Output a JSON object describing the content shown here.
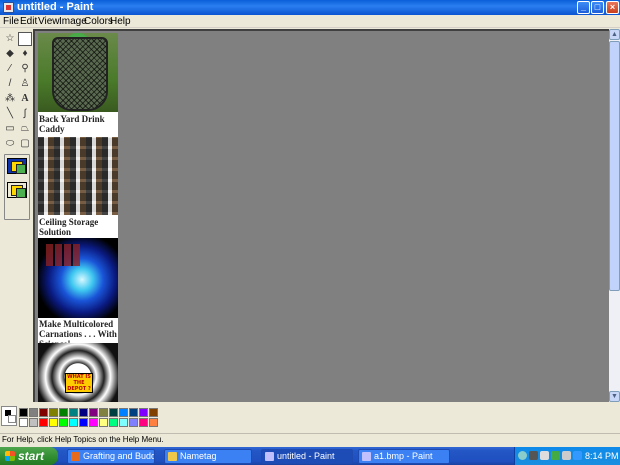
{
  "window": {
    "title": "untitled - Paint"
  },
  "titlebar_buttons": {
    "minimize": "_",
    "maximize": "□",
    "close": "×"
  },
  "menu": [
    {
      "label": "File"
    },
    {
      "label": "Edit"
    },
    {
      "label": "View"
    },
    {
      "label": "Image"
    },
    {
      "label": "Colors"
    },
    {
      "label": "Help"
    }
  ],
  "tools": [
    {
      "name": "free-select-icon",
      "glyph": "☆"
    },
    {
      "name": "rect-select-icon",
      "glyph": ""
    },
    {
      "name": "eraser-icon",
      "glyph": "◆"
    },
    {
      "name": "fill-icon",
      "glyph": "♦"
    },
    {
      "name": "eyedropper-icon",
      "glyph": "⁄"
    },
    {
      "name": "magnifier-icon",
      "glyph": "⚲"
    },
    {
      "name": "pencil-icon",
      "glyph": "/"
    },
    {
      "name": "brush-icon",
      "glyph": "♙"
    },
    {
      "name": "airbrush-icon",
      "glyph": "⁂"
    },
    {
      "name": "text-icon",
      "glyph": "A"
    },
    {
      "name": "line-icon",
      "glyph": "╲"
    },
    {
      "name": "curve-icon",
      "glyph": "∫"
    },
    {
      "name": "rectangle-icon",
      "glyph": "▭"
    },
    {
      "name": "polygon-icon",
      "glyph": "⏢"
    },
    {
      "name": "ellipse-icon",
      "glyph": "⬭"
    },
    {
      "name": "rounded-rect-icon",
      "glyph": "▢"
    }
  ],
  "canvas": {
    "captions": [
      "Back Yard Drink Caddy",
      "Ceiling Storage Solution",
      "Make Multicolored Carnations . . . With Science!"
    ],
    "sign_text": "WHAT IS THE DEPOT ?"
  },
  "palette": {
    "foreground": "#000000",
    "background": "#ffffff",
    "top_row": [
      "#000000",
      "#808080",
      "#800000",
      "#808000",
      "#008000",
      "#008080",
      "#000080",
      "#800080",
      "#808040",
      "#004040",
      "#0080ff",
      "#004080",
      "#8000ff",
      "#804000"
    ],
    "bottom_row": [
      "#ffffff",
      "#c0c0c0",
      "#ff0000",
      "#ffff00",
      "#00ff00",
      "#00ffff",
      "#0000ff",
      "#ff00ff",
      "#ffff80",
      "#00ff80",
      "#80ffff",
      "#8080ff",
      "#ff0080",
      "#ff8040"
    ]
  },
  "status": {
    "text": "For Help, click Help Topics on the Help Menu."
  },
  "taskbar": {
    "start_label": "start",
    "tasks": [
      {
        "label": "Grafting and Budding ...",
        "icon_color": "#e86a1c",
        "active": false
      },
      {
        "label": "Nametag",
        "icon_color": "#f0c84a",
        "active": false
      },
      {
        "label": "untitled - Paint",
        "icon_color": "#c0c0ff",
        "active": true
      },
      {
        "label": "a1.bmp - Paint",
        "icon_color": "#c0c0ff",
        "active": false
      }
    ],
    "clock": "8:14 PM"
  }
}
